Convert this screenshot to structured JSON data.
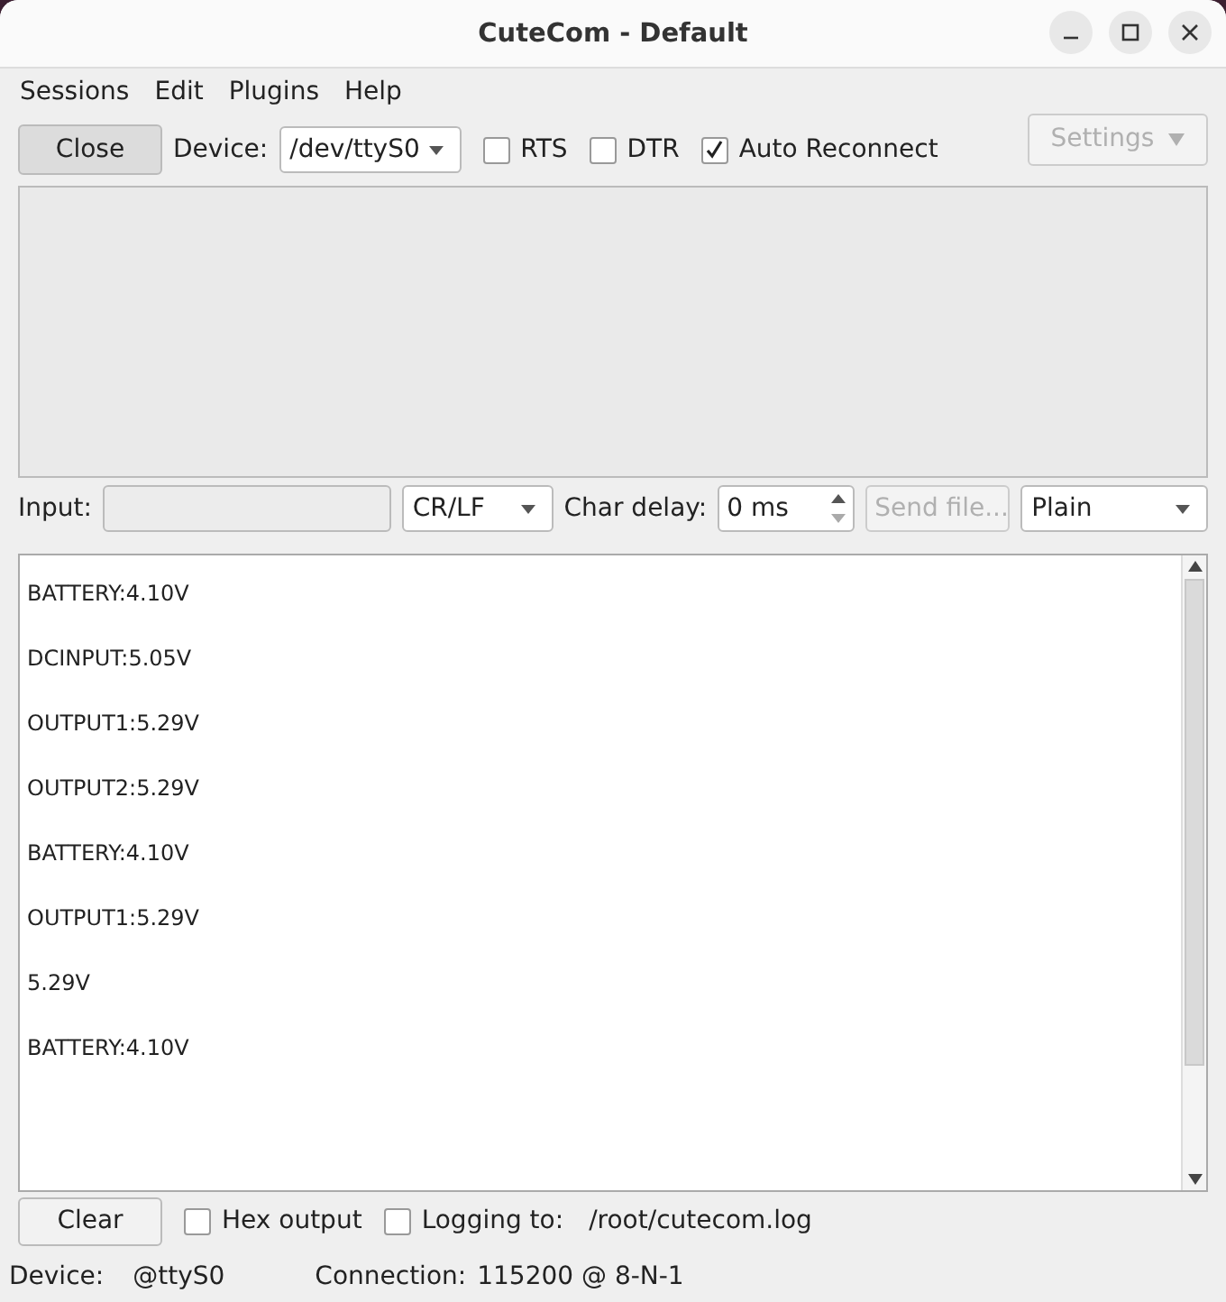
{
  "window": {
    "title": "CuteCom - Default"
  },
  "menu": [
    "Sessions",
    "Edit",
    "Plugins",
    "Help"
  ],
  "toolbar": {
    "close_button": "Close",
    "device_label": "Device:",
    "device_value": "/dev/ttyS0",
    "options": [
      {
        "label": "RTS",
        "checked": false
      },
      {
        "label": "DTR",
        "checked": false
      },
      {
        "label": "Auto Reconnect",
        "checked": true
      }
    ],
    "settings_button": {
      "label": "Settings",
      "disabled": true
    }
  },
  "input_row": {
    "label": "Input:",
    "line_ending": "CR/LF",
    "char_delay_label": "Char delay:",
    "char_delay_value": "0 ms",
    "send_file_button": {
      "label": "Send file...",
      "disabled": true
    },
    "format": "Plain"
  },
  "output": [
    "BATTERY:4.10V",
    "DCINPUT:5.05V",
    "OUTPUT1:5.29V",
    "OUTPUT2:5.29V",
    "BATTERY:4.10V",
    "OUTPUT1:5.29V",
    "5.29V",
    "BATTERY:4.10V"
  ],
  "bottom_row": {
    "clear_button": "Clear",
    "options": [
      {
        "label": "Hex output",
        "checked": false
      },
      {
        "label": "Logging to:",
        "checked": false
      }
    ],
    "log_path": "/root/cutecom.log"
  },
  "status_bar": {
    "device_label": "Device:",
    "device_value": "@ttyS0",
    "connection_label": "Connection:",
    "connection_value": "115200 @ 8-N-1"
  }
}
